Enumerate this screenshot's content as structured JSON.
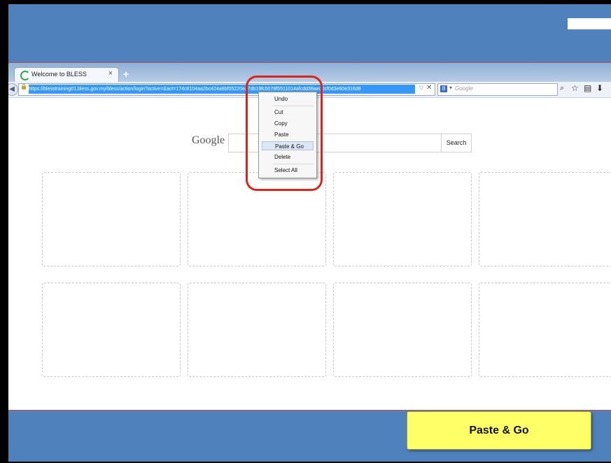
{
  "browser": {
    "tab_title": "Welcome to BLESS",
    "tab_close": "×",
    "new_tab": "+",
    "url": "https://blesstraining01.bless.gov.my/bless/action/login?active=&act=174c8104aa2bc424a8bf05220ea7db19fc5078f5511014afcdd38aed0cf0d3e60e316d8",
    "url_dropdown": "▽",
    "url_stop": "✕",
    "search_engine_letter": "8",
    "search_engine_arrow": "▾",
    "search_placeholder": "Google",
    "back_glyph": "◀"
  },
  "google": {
    "logo": "Google",
    "search_button": "Search"
  },
  "context_menu": {
    "items": [
      "Undo",
      "Cut",
      "Copy",
      "Paste",
      "Paste & Go",
      "Delete",
      "Select All"
    ],
    "active_item": "Paste & Go"
  },
  "callout": {
    "label": "Paste & Go"
  },
  "icons": {
    "search": "⌕",
    "star": "☆",
    "clipboard": "▤",
    "download": "⬇"
  },
  "colors": {
    "slide_blue": "#4f81bd",
    "callout_yellow": "#ffff66",
    "highlight_red": "#e2231a",
    "url_selection": "#3399ff"
  }
}
